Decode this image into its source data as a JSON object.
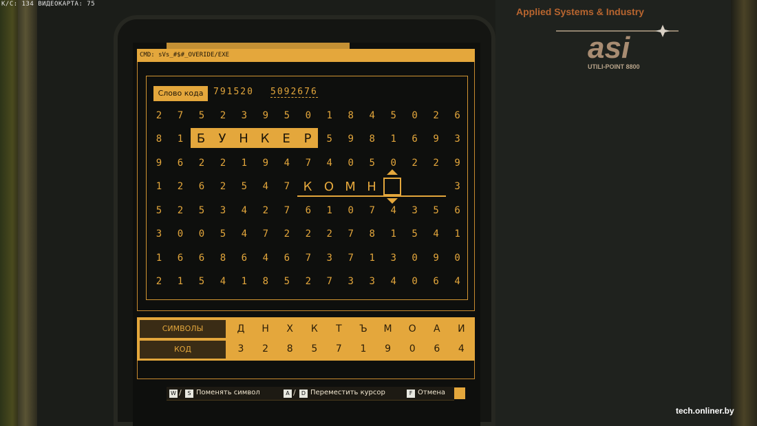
{
  "hud": {
    "fps_text": "К/С: 134 ВИДЕОКАРТА: 75"
  },
  "brand": {
    "company": "Applied Systems & Industry",
    "logo_text": "asi",
    "model": "UTILI-POINT 8800"
  },
  "terminal": {
    "cmd": "CMD: sVs_#$#_OVERIDE/EXE",
    "code_label": "Слово кода",
    "code_prefix": "791520",
    "code_target": "5092676",
    "grid": [
      [
        "2",
        "7",
        "5",
        "2",
        "3",
        "9",
        "5",
        "0",
        "1",
        "8",
        "4",
        "5",
        "0",
        "2",
        "6"
      ],
      [
        "8",
        "1",
        "",
        "",
        "",
        "",
        "",
        "",
        "5",
        "9",
        "8",
        "1",
        "6",
        "9",
        "3"
      ],
      [
        "9",
        "6",
        "2",
        "2",
        "1",
        "9",
        "4",
        "7",
        "4",
        "0",
        "5",
        "0",
        "2",
        "2",
        "9"
      ],
      [
        "1",
        "2",
        "6",
        "2",
        "5",
        "4",
        "7",
        "",
        "",
        "",
        "",
        "",
        "",
        "",
        "3"
      ],
      [
        "5",
        "2",
        "5",
        "3",
        "4",
        "2",
        "7",
        "6",
        "1",
        "0",
        "7",
        "4",
        "3",
        "5",
        "6"
      ],
      [
        "3",
        "0",
        "0",
        "5",
        "4",
        "7",
        "2",
        "2",
        "2",
        "7",
        "8",
        "1",
        "5",
        "4",
        "1"
      ],
      [
        "1",
        "6",
        "6",
        "8",
        "6",
        "4",
        "6",
        "7",
        "3",
        "7",
        "1",
        "3",
        "0",
        "9",
        "0"
      ],
      [
        "2",
        "1",
        "5",
        "4",
        "1",
        "8",
        "5",
        "2",
        "7",
        "3",
        "3",
        "4",
        "0",
        "6",
        "4"
      ]
    ],
    "found_word": [
      "Б",
      "У",
      "Н",
      "К",
      "Е",
      "Р"
    ],
    "input_word": [
      "К",
      "О",
      "М",
      "Н"
    ]
  },
  "cipher": {
    "symbols_label": "СИМВОЛЫ",
    "code_label": "КОД",
    "symbols": [
      "Д",
      "Н",
      "Х",
      "К",
      "Т",
      "Ъ",
      "М",
      "О",
      "А",
      "И"
    ],
    "codes": [
      "3",
      "2",
      "8",
      "5",
      "7",
      "1",
      "9",
      "0",
      "6",
      "4"
    ]
  },
  "hints": {
    "key_w": "W",
    "key_s": "S",
    "change_symbol": "Поменять символ",
    "key_a": "A",
    "key_d": "D",
    "move_cursor": "Переместить курсор",
    "key_f": "F",
    "cancel": "Отмена"
  },
  "watermark": "tech.onliner.by"
}
